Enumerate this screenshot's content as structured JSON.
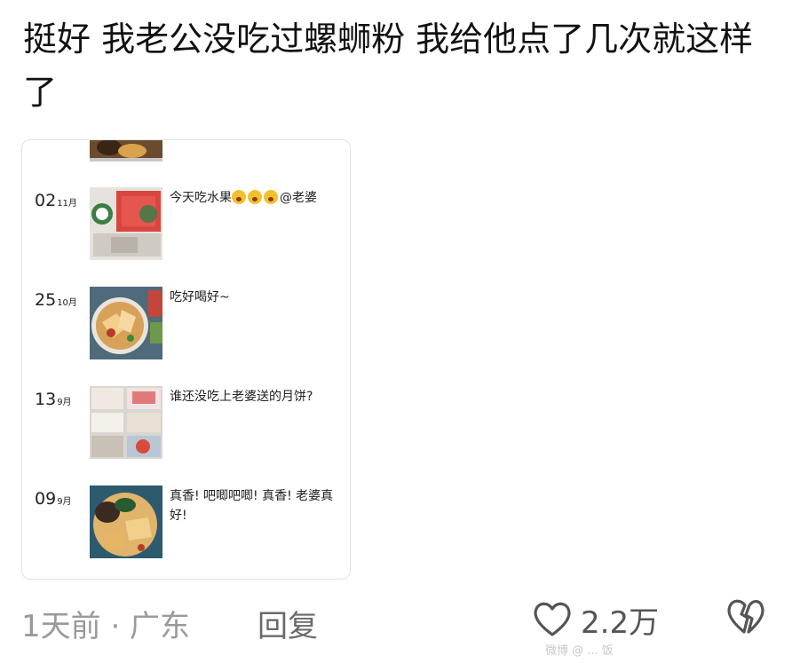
{
  "comment": {
    "text": "挺好 我老公没吃过螺蛳粉 我给他点了几次就这样了"
  },
  "screenshot": {
    "posts": [
      {
        "day": "02",
        "month": "11月",
        "caption_prefix": "今天吃水果",
        "caption_suffix": "@老婆",
        "emoji_count": 3
      },
      {
        "day": "25",
        "month": "10月",
        "caption": "吃好喝好~"
      },
      {
        "day": "13",
        "month": "9月",
        "caption": "谁还没吃上老婆送的月饼?"
      },
      {
        "day": "09",
        "month": "9月",
        "caption": "真香! 吧唧吧唧! 真香! 老婆真好!"
      }
    ]
  },
  "footer": {
    "time_location": "1天前 · 广东",
    "reply_label": "回复",
    "like_count": "2.2万"
  },
  "watermark": {
    "text": "微博 @ ... 饭"
  },
  "icons": {
    "like": "heart-outline-icon",
    "dislike": "broken-heart-icon"
  },
  "colors": {
    "meta_gray": "#9a9a9a",
    "reply_gray": "#6a6a6a",
    "card_border": "#e2e2e2"
  }
}
